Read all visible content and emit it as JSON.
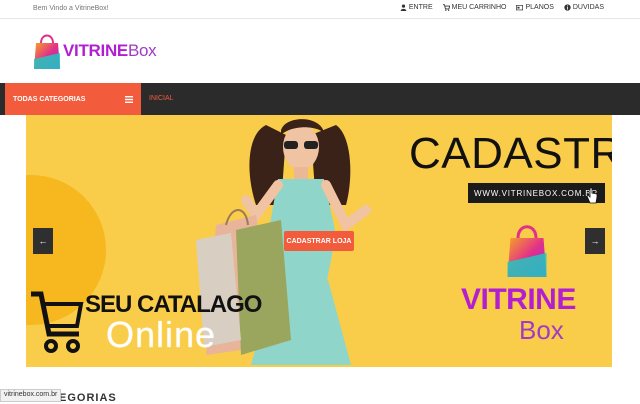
{
  "topbar": {
    "welcome": "Bem Vindo a VitrineBox!",
    "links": [
      {
        "label": "ENTRE",
        "icon": "user-icon"
      },
      {
        "label": "MEU CARRINHO",
        "icon": "cart-icon"
      },
      {
        "label": "PLANOS",
        "icon": "card-icon"
      },
      {
        "label": "DUVIDAS",
        "icon": "info-icon"
      }
    ]
  },
  "logo": {
    "part1": "VITRINE",
    "part2": "Box"
  },
  "nav": {
    "categories_label": "TODAS CATEGORIAS",
    "home_link": "INICIAL"
  },
  "banner": {
    "headline": "CADASTRE",
    "url": "WWW.VITRINEBOX.COM.BR",
    "cta": "CADASTRAR LOJA",
    "catalog_line1": "SEU CATALAGO",
    "catalog_line2": "Online",
    "brand_part1": "VITRINE",
    "brand_part2": "Box",
    "prev": "←",
    "next": "→"
  },
  "colors": {
    "accent": "#f25c3d",
    "banner": "#f9cd4a",
    "brand": "#b21fd1",
    "nav": "#2b2b2b"
  },
  "status_url": "vitrinebox.com.br",
  "section_peek": "EGORIAS"
}
